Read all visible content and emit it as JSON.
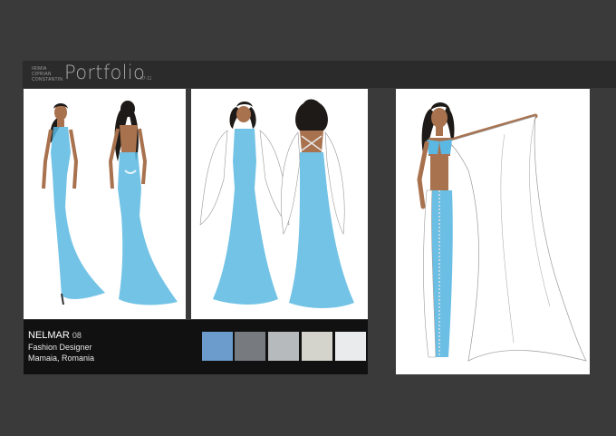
{
  "header": {
    "names": [
      "IRIMIA",
      "CIPRIAN",
      "CONSTANTIN"
    ],
    "title": "Portfolio",
    "page": "07-11"
  },
  "info": {
    "brand": "NELMAR",
    "brand_number": "08",
    "role": "Fashion Designer",
    "location": "Mamaia, Romania"
  },
  "swatches": [
    {
      "name": "sky-blue",
      "color": "#6b9ccb"
    },
    {
      "name": "slate-grey",
      "color": "#777b80"
    },
    {
      "name": "silver",
      "color": "#b7babd"
    },
    {
      "name": "ivory",
      "color": "#d4d4cc"
    },
    {
      "name": "white",
      "color": "#e9ebec"
    }
  ],
  "colors": {
    "background": "#3a3a3a",
    "header_bar": "#2b2b2b",
    "info_bar": "#111111",
    "dress_blue": "#5bb8e2",
    "skin": "#a8724f",
    "hair": "#1e1a18"
  },
  "illustrations": [
    {
      "name": "sketch-mermaid-gown-front-back"
    },
    {
      "name": "sketch-gown-with-sheer-cape-front-back"
    },
    {
      "name": "sketch-two-piece-gown-with-flowing-cape"
    }
  ]
}
